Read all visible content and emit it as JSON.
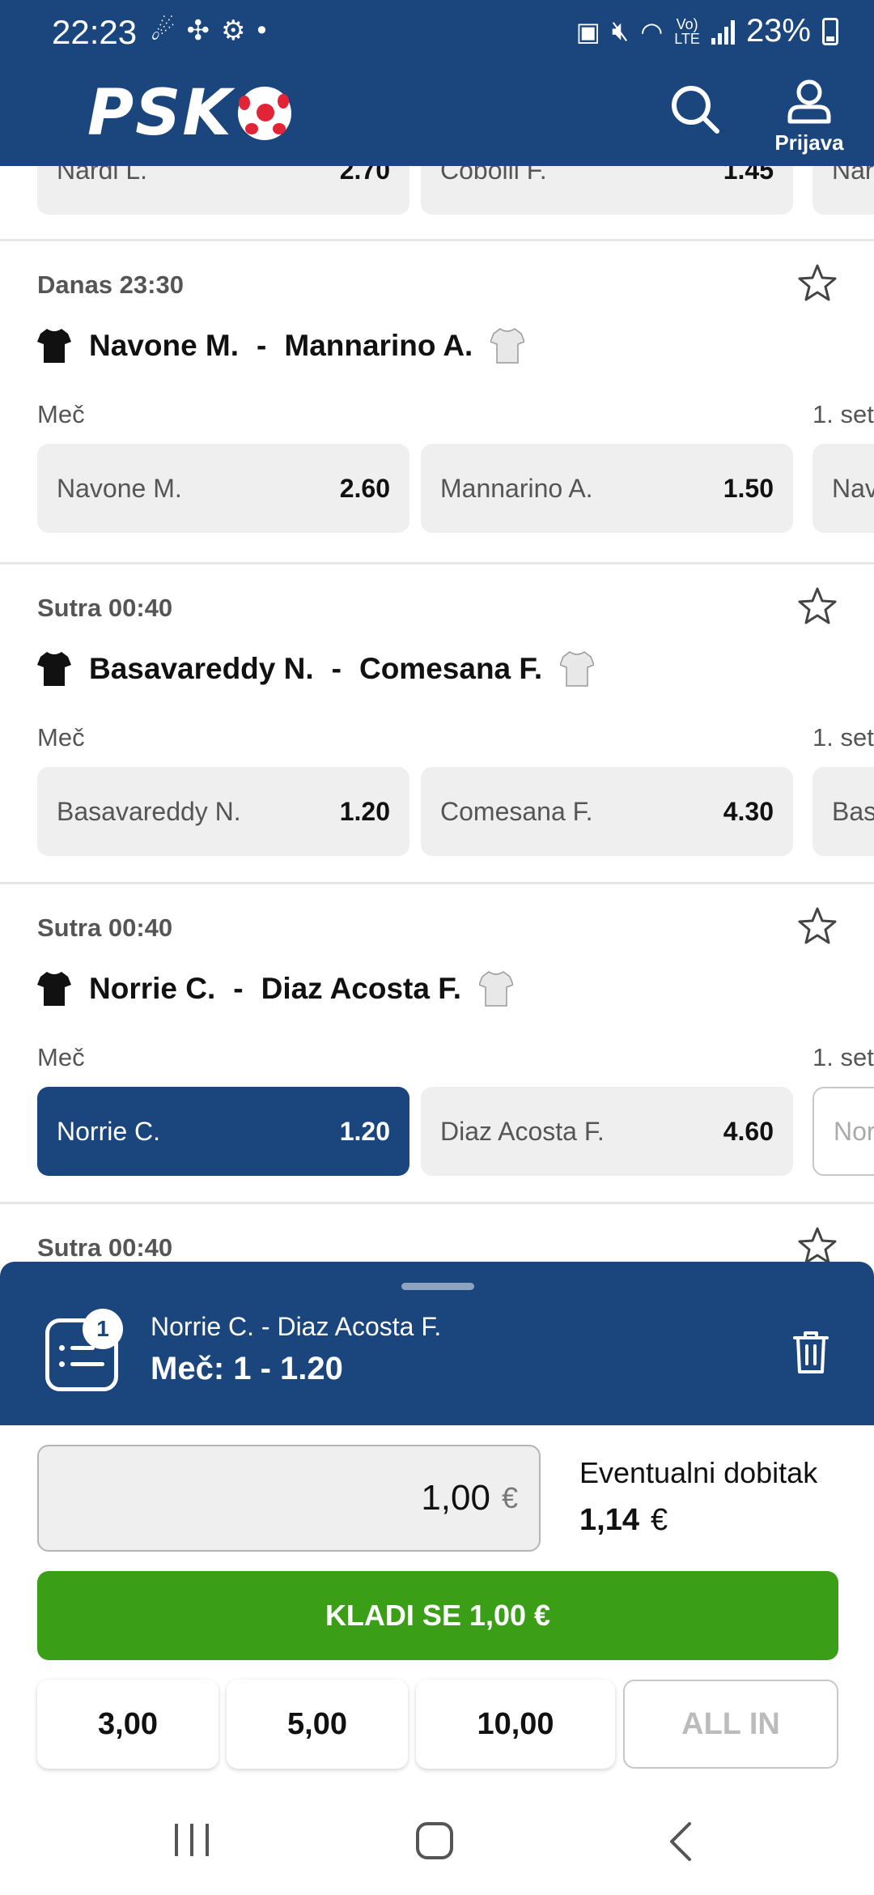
{
  "status": {
    "time": "22:23",
    "battery": "23%"
  },
  "header": {
    "logo": "PSK",
    "profile_label": "Prijava"
  },
  "partial_row": {
    "odds": [
      {
        "label": "Nardi L.",
        "value": "2.70"
      },
      {
        "label": "Cobolli F.",
        "value": "1.45"
      },
      {
        "label": "Nar",
        "value": ""
      }
    ]
  },
  "matches": [
    {
      "time": "Danas 23:30",
      "home": "Navone M.",
      "away": "Mannarino A.",
      "separator": "-",
      "market": "Meč",
      "market2": "1. set",
      "odds": [
        {
          "label": "Navone M.",
          "value": "2.60"
        },
        {
          "label": "Mannarino A.",
          "value": "1.50"
        },
        {
          "label": "Nav",
          "value": ""
        }
      ]
    },
    {
      "time": "Sutra 00:40",
      "home": "Basavareddy N.",
      "away": "Comesana F.",
      "separator": "-",
      "market": "Meč",
      "market2": "1. set",
      "odds": [
        {
          "label": "Basavareddy N.",
          "value": "1.20"
        },
        {
          "label": "Comesana F.",
          "value": "4.30"
        },
        {
          "label": "Bas",
          "value": ""
        }
      ]
    },
    {
      "time": "Sutra 00:40",
      "home": "Norrie C.",
      "away": "Diaz Acosta F.",
      "separator": "-",
      "market": "Meč",
      "market2": "1. set",
      "odds": [
        {
          "label": "Norrie C.",
          "value": "1.20"
        },
        {
          "label": "Diaz Acosta F.",
          "value": "4.60"
        },
        {
          "label": "Nor",
          "value": ""
        }
      ]
    },
    {
      "time": "Sutra 00:40"
    }
  ],
  "slip": {
    "count": "1",
    "match": "Norrie C. - Diaz Acosta F.",
    "pick": "Meč:  1 - 1.20"
  },
  "stake": {
    "value": "1,00",
    "currency": "€",
    "win_label": "Eventualni dobitak",
    "win_value": "1,14",
    "win_currency": "€"
  },
  "bet_button": "KLADI SE 1,00 €",
  "quick_stakes": [
    "3,00",
    "5,00",
    "10,00"
  ],
  "all_in": "ALL IN",
  "colors": {
    "brand": "#1a457d",
    "bet": "#3a9f16",
    "odds_bg": "#efefef",
    "ball_red": "#e32437"
  }
}
